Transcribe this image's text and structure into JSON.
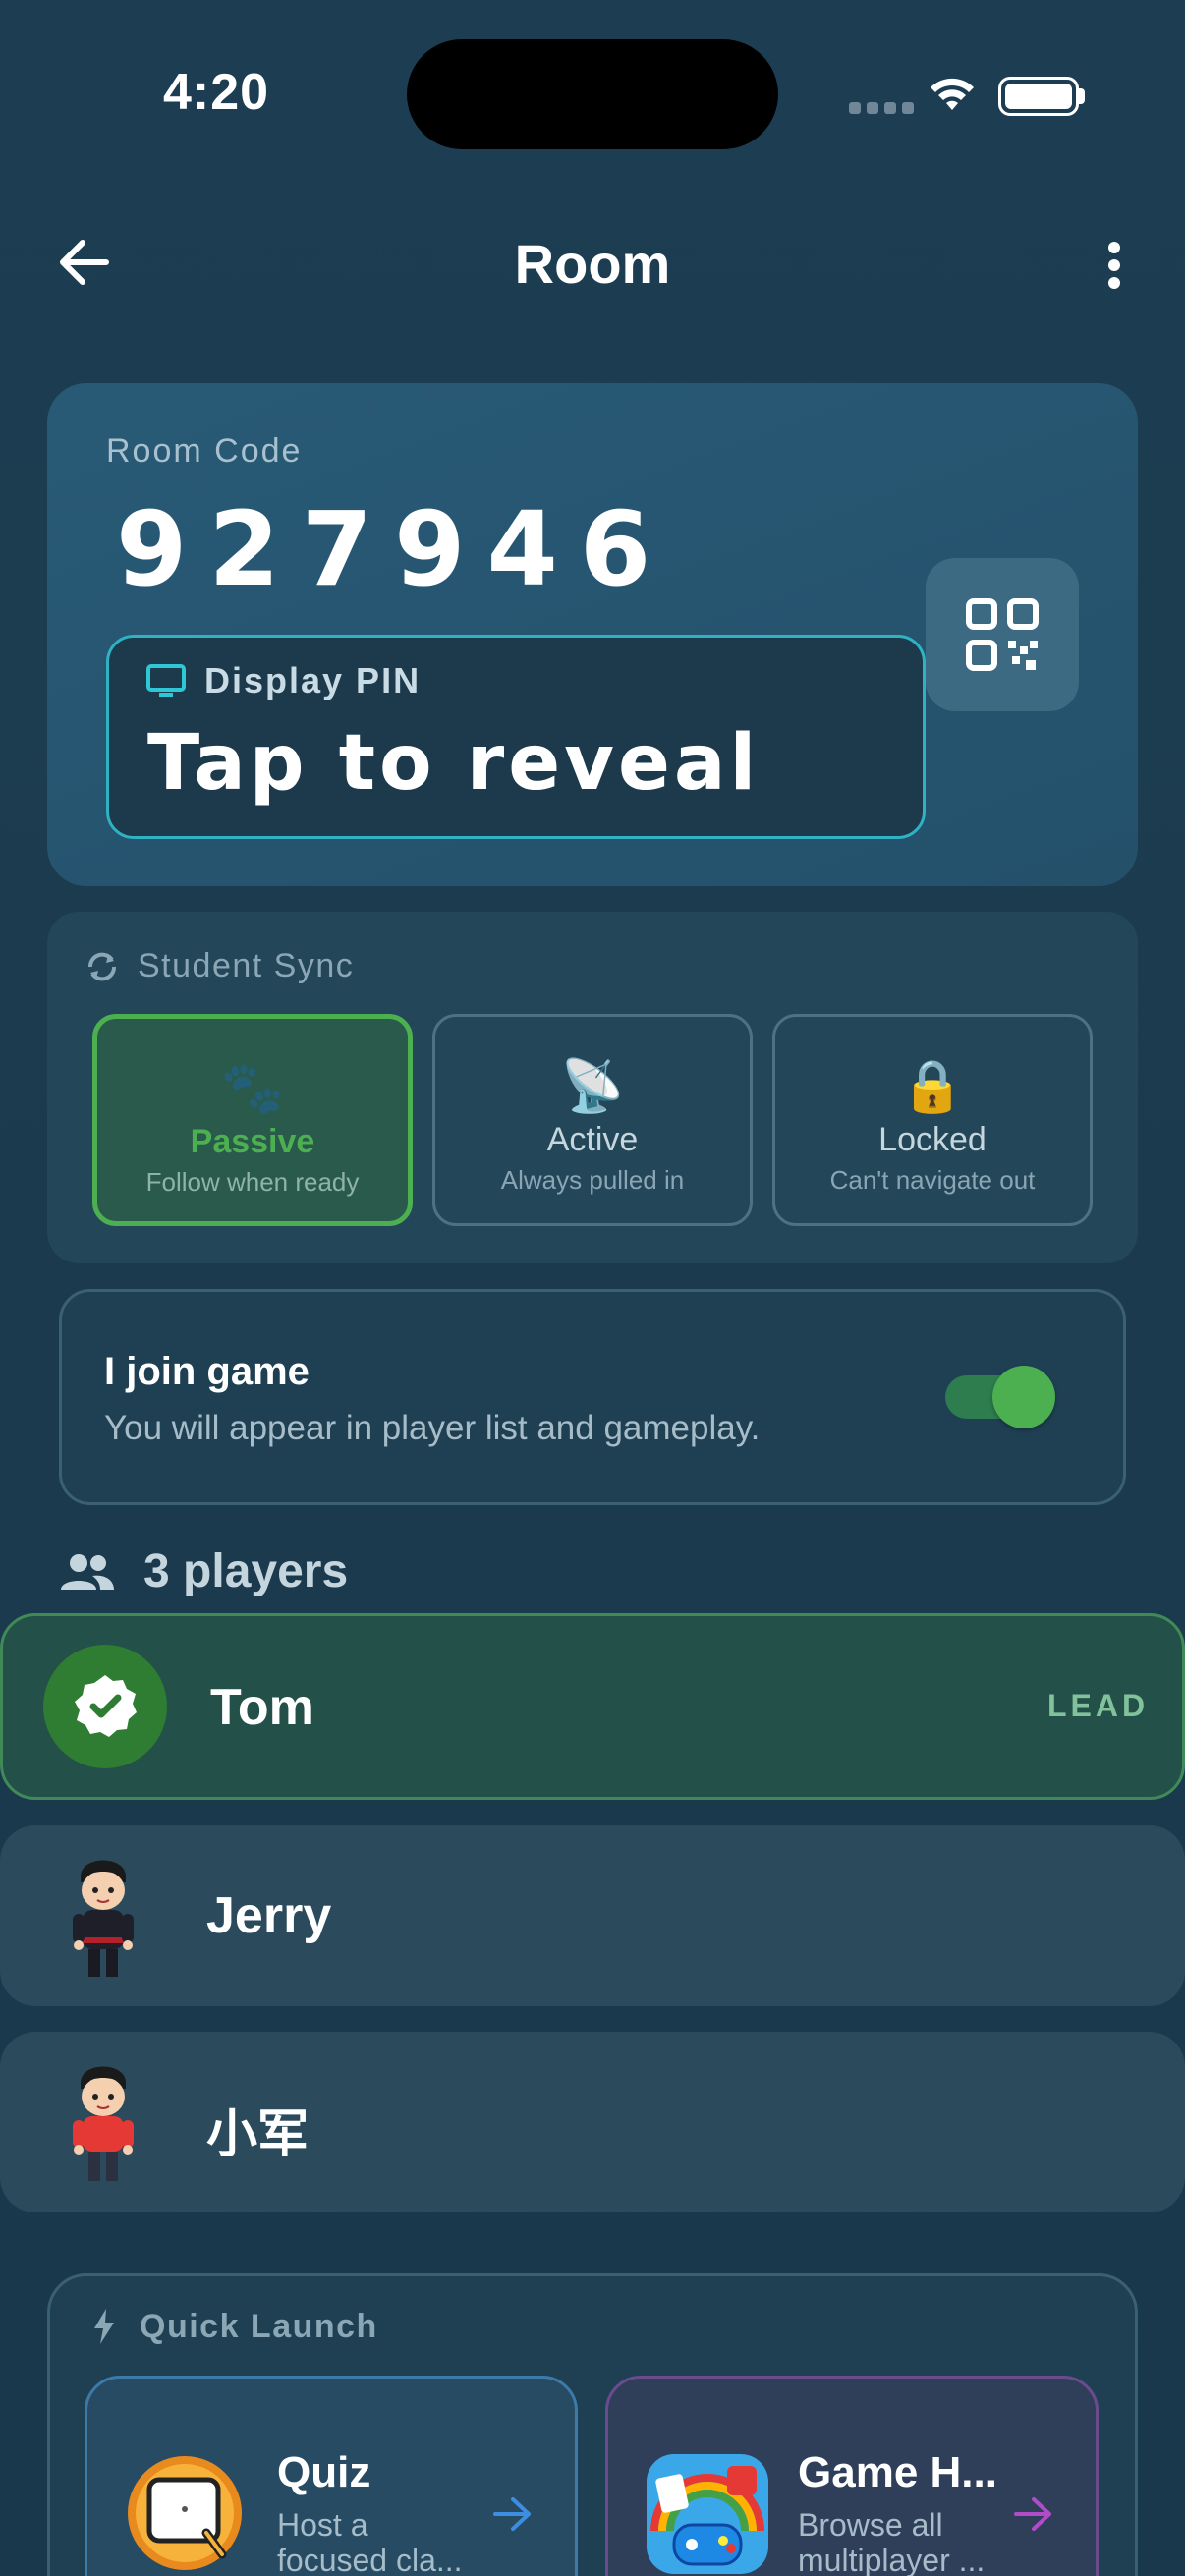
{
  "status_bar": {
    "time": "4:20"
  },
  "app_bar": {
    "title": "Room"
  },
  "room": {
    "code_label": "Room Code",
    "code": "927946",
    "pin_label": "Display PIN",
    "pin_value": "Tap to reveal"
  },
  "sync": {
    "title": "Student Sync",
    "selected": "Passive",
    "modes": [
      {
        "icon": "🐾",
        "name": "Passive",
        "desc": "Follow when ready"
      },
      {
        "icon": "📡",
        "name": "Active",
        "desc": "Always pulled in"
      },
      {
        "icon": "🔒",
        "name": "Locked",
        "desc": "Can't navigate out"
      }
    ]
  },
  "join": {
    "title": "I join game",
    "desc": "You will appear in player list and gameplay.",
    "enabled": true
  },
  "players": {
    "count_label": "3 players",
    "list": [
      {
        "name": "Tom",
        "badge": "LEAD",
        "avatar": "verified-badge-icon"
      },
      {
        "name": "Jerry",
        "badge": "",
        "avatar": "cartoon-boy-dark-shirt"
      },
      {
        "name": "小军",
        "badge": "",
        "avatar": "cartoon-boy-red-shirt"
      }
    ]
  },
  "quick_launch": {
    "title": "Quick Launch",
    "tiles": [
      {
        "name": "Quiz",
        "desc_line1": "Host a",
        "desc_line2": "focused cla...",
        "accent": "#3d8de0"
      },
      {
        "name": "Game H...",
        "desc_line1": "Browse all",
        "desc_line2": "multiplayer ...",
        "accent": "#b04cc8"
      }
    ]
  },
  "colors": {
    "background": "#1b3a4e",
    "success": "#4caf50",
    "pin_border": "#2fb3c3"
  }
}
